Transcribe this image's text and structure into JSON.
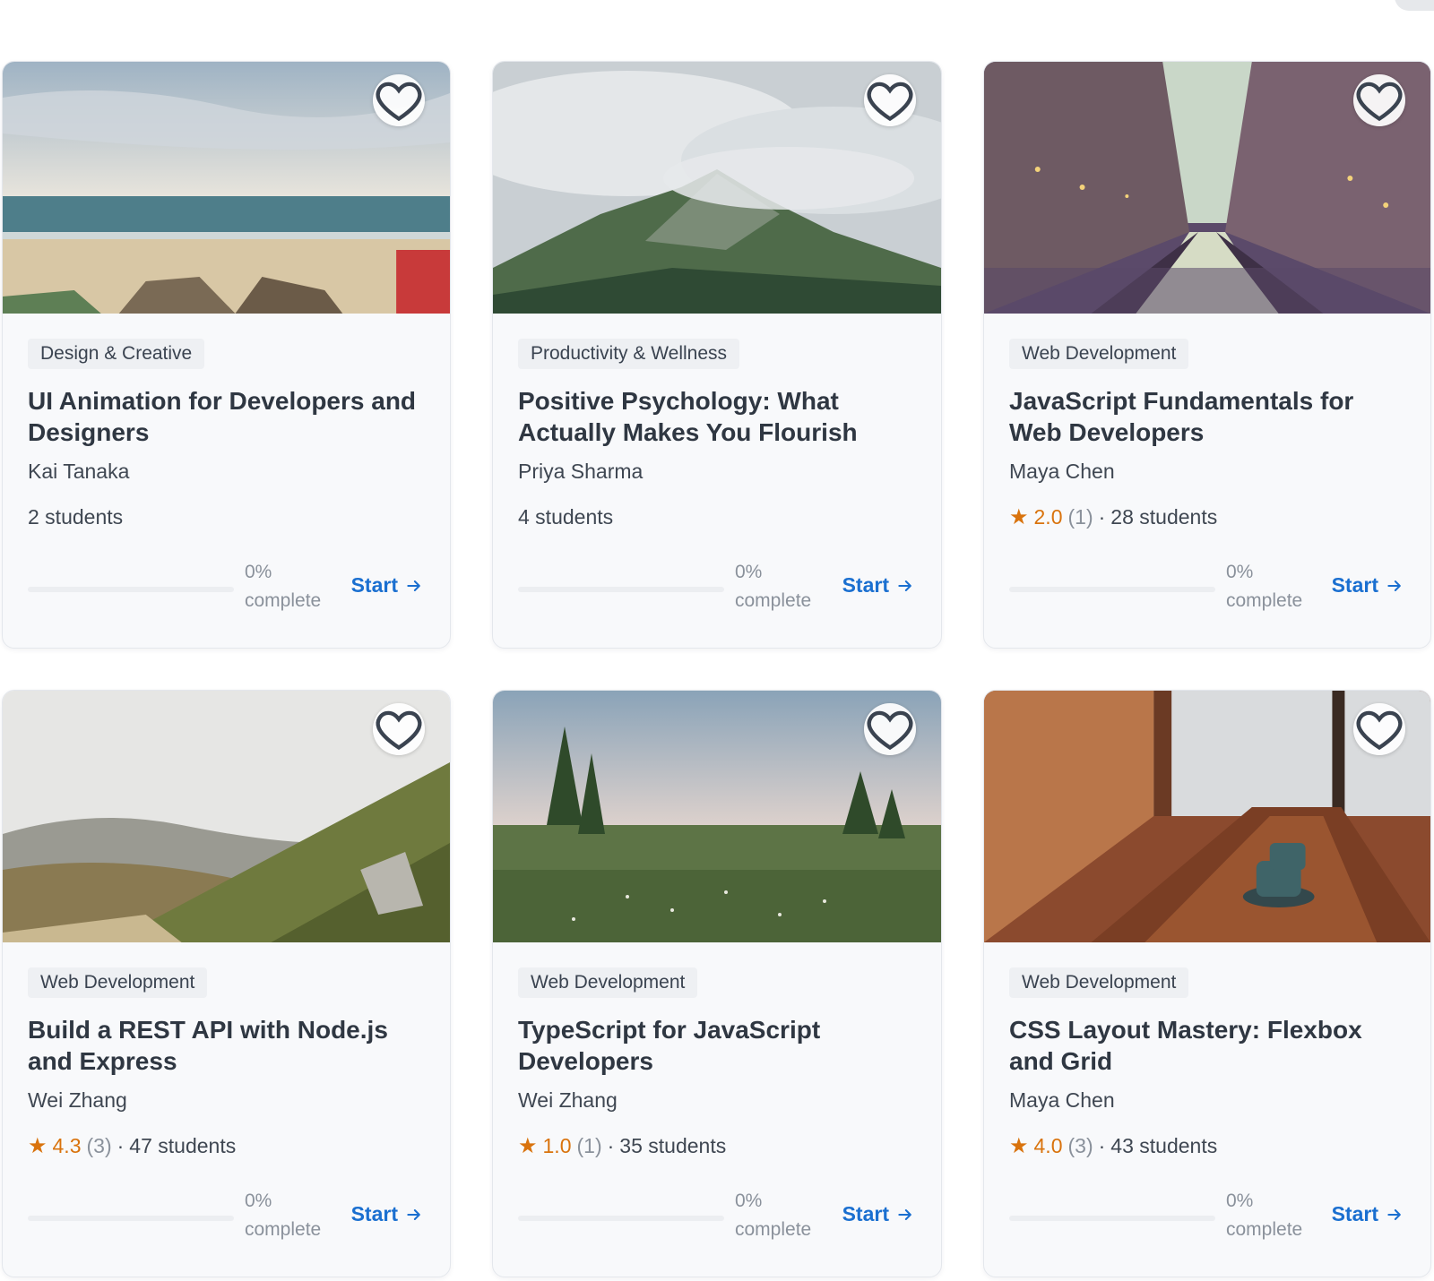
{
  "colors": {
    "accent": "#1a6fd0",
    "star": "#d9730d"
  },
  "cards": [
    {
      "category": "Design & Creative",
      "title": "UI Animation for Developers and Designers",
      "author": "Kai Tanaka",
      "students": "2 students",
      "progress_label": "0%",
      "progress_suffix": "complete",
      "progress_value": 0,
      "start_label": "Start",
      "image": "beach"
    },
    {
      "category": "Productivity & Wellness",
      "title": "Positive Psychology: What Actually Makes You Flourish",
      "author": "Priya Sharma",
      "students": "4 students",
      "progress_label": "0%",
      "progress_suffix": "complete",
      "progress_value": 0,
      "start_label": "Start",
      "image": "misty-mountain"
    },
    {
      "category": "Web Development",
      "title": "JavaScript Fundamentals for Web Developers",
      "author": "Maya Chen",
      "rating": "2.0",
      "rating_count": "(1)",
      "students": "28 students",
      "progress_label": "0%",
      "progress_suffix": "complete",
      "progress_value": 0,
      "start_label": "Start",
      "image": "canal-city"
    },
    {
      "category": "Web Development",
      "title": "Build a REST API with Node.js and Express",
      "author": "Wei Zhang",
      "rating": "4.3",
      "rating_count": "(3)",
      "students": "47 students",
      "progress_label": "0%",
      "progress_suffix": "complete",
      "progress_value": 0,
      "start_label": "Start",
      "image": "hillside"
    },
    {
      "category": "Web Development",
      "title": "TypeScript for JavaScript Developers",
      "author": "Wei Zhang",
      "rating": "1.0",
      "rating_count": "(1)",
      "students": "35 students",
      "progress_label": "0%",
      "progress_suffix": "complete",
      "progress_value": 0,
      "start_label": "Start",
      "image": "meadow-trees"
    },
    {
      "category": "Web Development",
      "title": "CSS Layout Mastery: Flexbox and Grid",
      "author": "Maya Chen",
      "rating": "4.0",
      "rating_count": "(3)",
      "students": "43 students",
      "progress_label": "0%",
      "progress_suffix": "complete",
      "progress_value": 0,
      "start_label": "Start",
      "image": "cafe-table"
    }
  ]
}
